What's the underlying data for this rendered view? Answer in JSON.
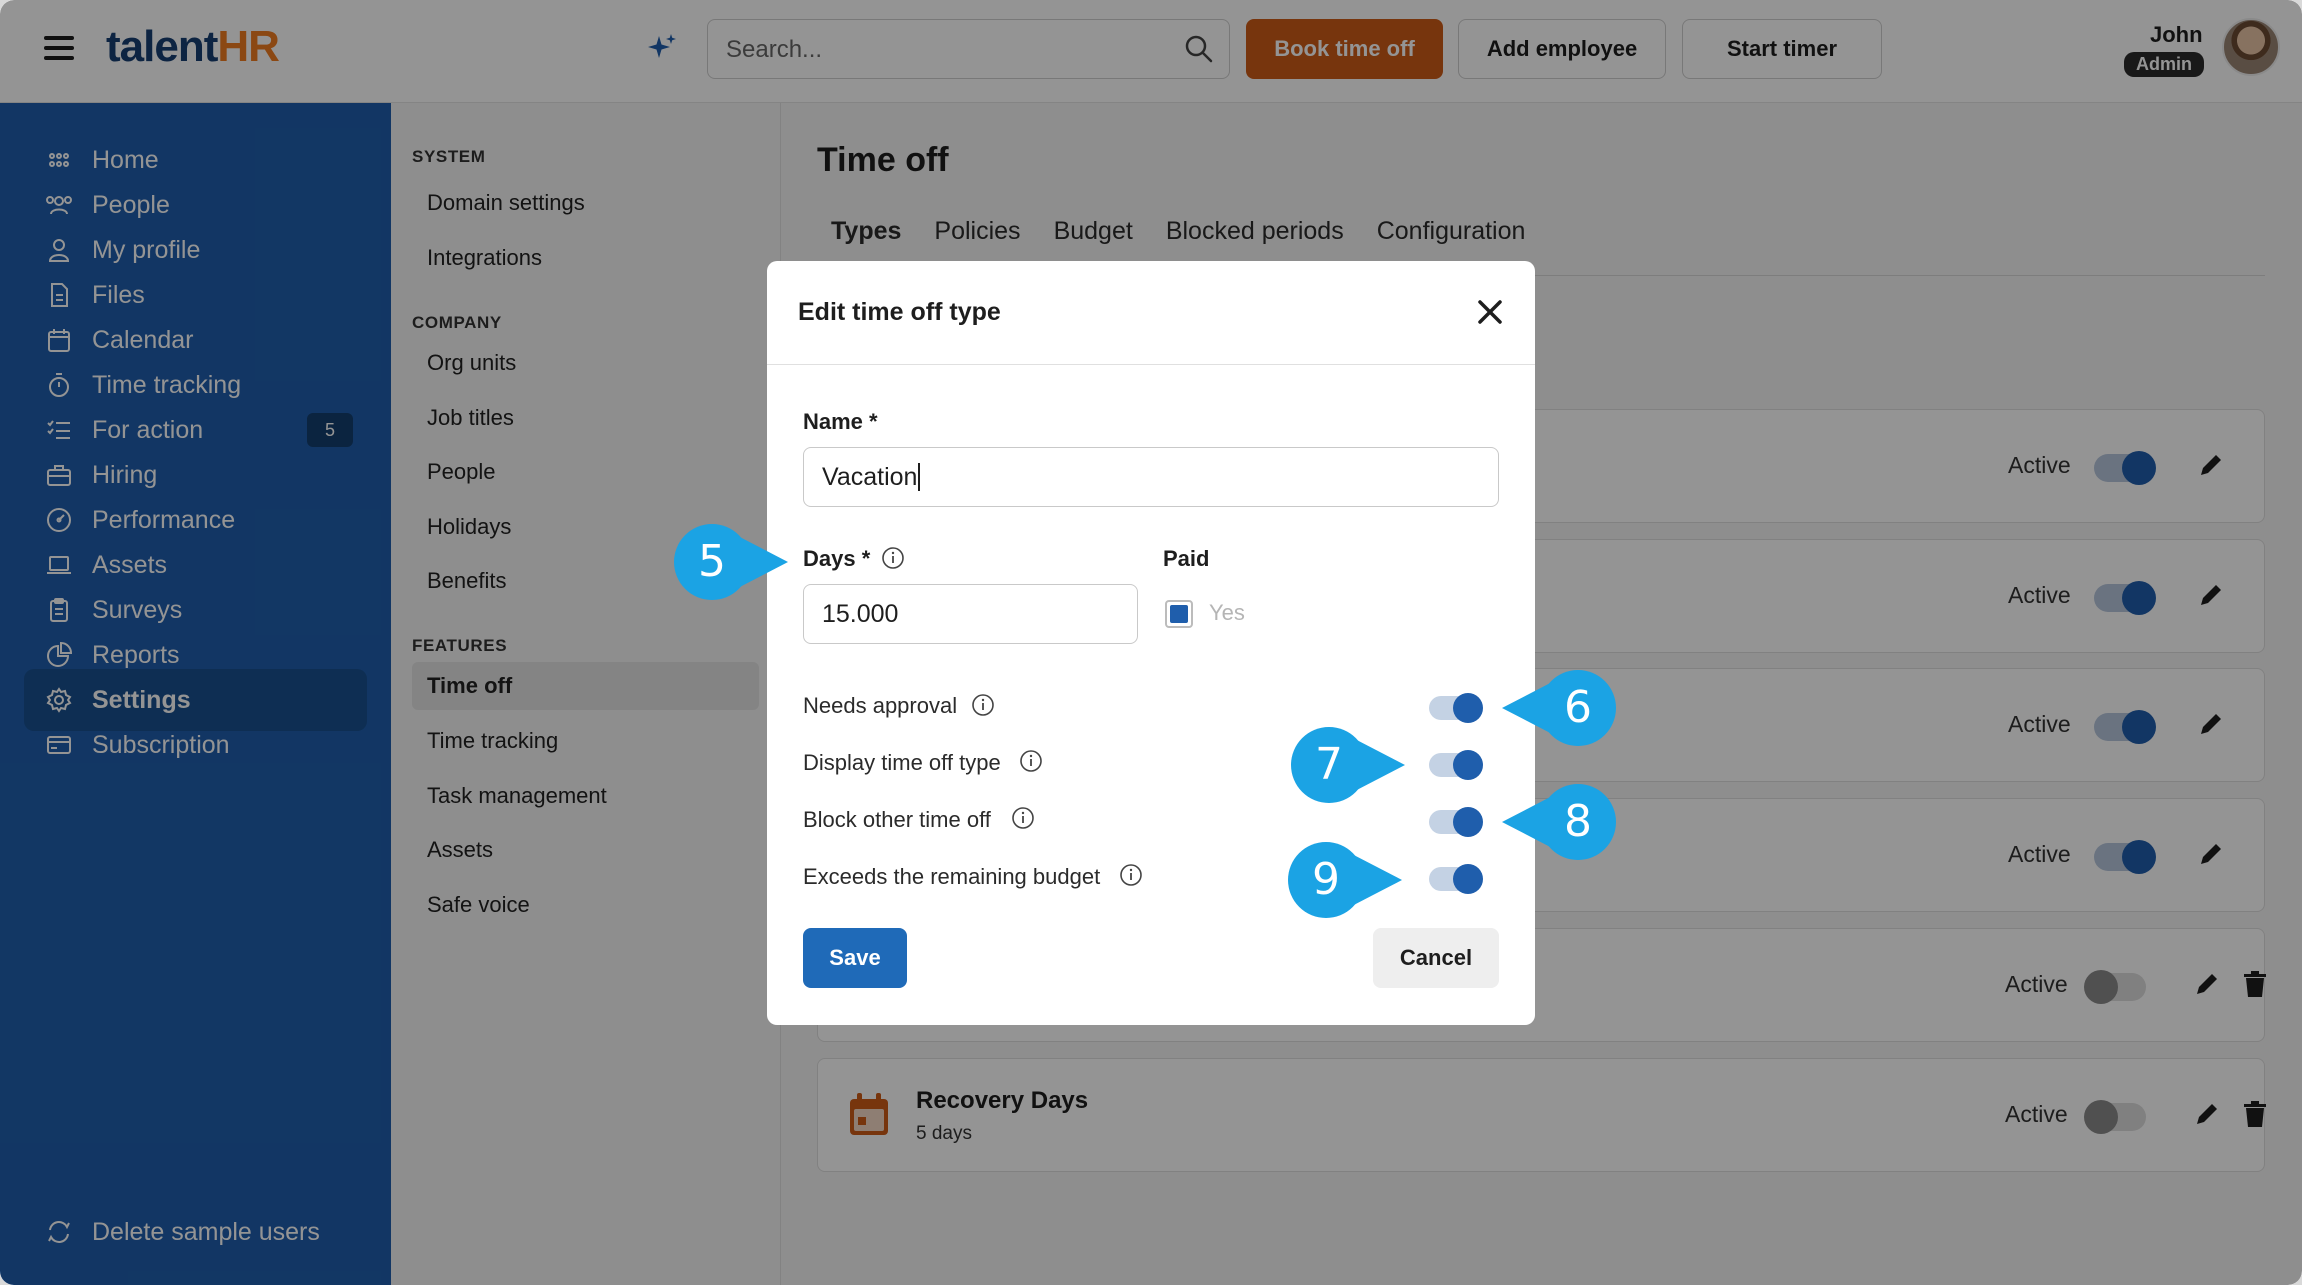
{
  "topbar": {
    "logo_part1": "talent",
    "logo_part2": "HR",
    "search_placeholder": "Search...",
    "book_time_off": "Book time off",
    "add_employee": "Add employee",
    "start_timer": "Start timer",
    "user_name": "John",
    "user_role": "Admin"
  },
  "sidebar": {
    "items": [
      {
        "label": "Home",
        "icon": "home-grid-icon"
      },
      {
        "label": "People",
        "icon": "people-icon"
      },
      {
        "label": "My profile",
        "icon": "user-icon"
      },
      {
        "label": "Files",
        "icon": "file-icon"
      },
      {
        "label": "Calendar",
        "icon": "calendar-icon"
      },
      {
        "label": "Time tracking",
        "icon": "stopwatch-icon"
      },
      {
        "label": "For action",
        "icon": "checklist-icon",
        "badge": "5"
      },
      {
        "label": "Hiring",
        "icon": "briefcase-icon"
      },
      {
        "label": "Performance",
        "icon": "gauge-icon"
      },
      {
        "label": "Assets",
        "icon": "laptop-icon"
      },
      {
        "label": "Surveys",
        "icon": "clipboard-icon"
      },
      {
        "label": "Reports",
        "icon": "pie-chart-icon"
      },
      {
        "label": "Settings",
        "icon": "gear-icon",
        "active": true
      },
      {
        "label": "Subscription",
        "icon": "card-icon"
      }
    ],
    "footer": "Delete sample users"
  },
  "settings_nav": {
    "system_heading": "SYSTEM",
    "system": [
      "Domain settings",
      "Integrations"
    ],
    "company_heading": "COMPANY",
    "company": [
      "Org units",
      "Job titles",
      "People",
      "Holidays",
      "Benefits"
    ],
    "features_heading": "FEATURES",
    "features": [
      "Time off",
      "Time tracking",
      "Task management",
      "Assets",
      "Safe voice"
    ]
  },
  "main": {
    "title": "Time off",
    "tabs": [
      "Types",
      "Policies",
      "Budget",
      "Blocked periods",
      "Configuration"
    ],
    "status_label": "Active",
    "last_type": {
      "name": "Recovery Days",
      "sub": "5 days"
    }
  },
  "modal": {
    "title": "Edit time off type",
    "name_label": "Name *",
    "name_value": "Vacation",
    "days_label": "Days *",
    "days_value": "15.000",
    "paid_label": "Paid",
    "paid_option": "Yes",
    "rows": [
      "Needs approval",
      "Display time off type",
      "Block other time off",
      "Exceeds the remaining budget"
    ],
    "save": "Save",
    "cancel": "Cancel"
  },
  "callouts": [
    "5",
    "6",
    "7",
    "8",
    "9"
  ],
  "colors": {
    "brand_blue": "#1f5eac",
    "brand_orange": "#f07c22",
    "callout": "#1ba3e4",
    "book_button": "#ce5c18"
  }
}
